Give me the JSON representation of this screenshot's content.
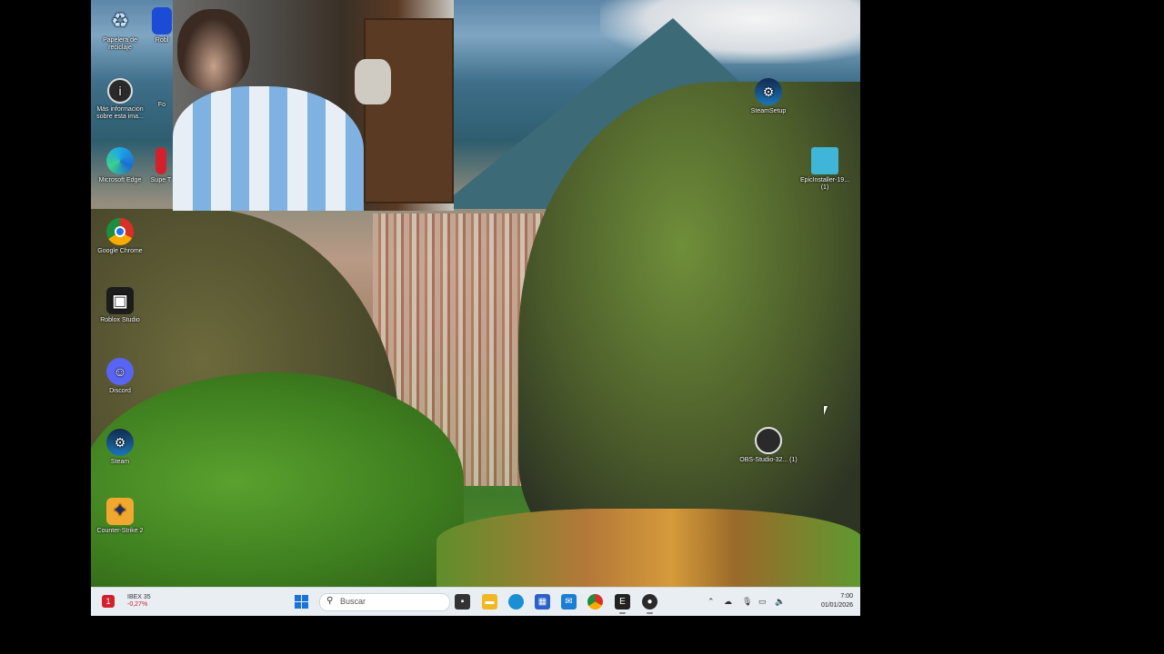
{
  "desktop": {
    "icons_left": [
      {
        "label": "Papelera de reciclaje",
        "icon": "recycle-bin-icon"
      },
      {
        "label": "Más información sobre esta ima...",
        "icon": "info-icon"
      },
      {
        "label": "Microsoft Edge",
        "icon": "edge-icon"
      },
      {
        "label": "Google Chrome",
        "icon": "chrome-icon"
      },
      {
        "label": "Roblox Studio",
        "icon": "roblox-studio-icon"
      },
      {
        "label": "Discord",
        "icon": "discord-icon"
      },
      {
        "label": "Steam",
        "icon": "steam-icon"
      },
      {
        "label": "Counter-Strike 2",
        "icon": "counter-strike-icon"
      }
    ],
    "icons_partial": [
      {
        "label": "Robl",
        "icon": "roblox-icon"
      },
      {
        "label": "Fo",
        "icon": "unknown-icon"
      },
      {
        "label": "Supe T",
        "icon": "app-icon"
      }
    ],
    "icons_right": [
      {
        "label": "SteamSetup",
        "icon": "steam-setup-icon"
      },
      {
        "label": "EpicInstaller-19... (1)",
        "icon": "epic-installer-icon"
      },
      {
        "label": "OBS-Studio-32... (1)",
        "icon": "obs-studio-icon"
      }
    ]
  },
  "taskbar": {
    "weather": {
      "label": "IBEX 35",
      "change": "-0,27%",
      "badge": "1"
    },
    "search_placeholder": "Buscar",
    "apps": [
      {
        "name": "task-view-icon",
        "color": "#333333"
      },
      {
        "name": "file-explorer-icon",
        "color": "#f2b824"
      },
      {
        "name": "edge-icon",
        "color": "#1b8fd6"
      },
      {
        "name": "store-icon",
        "color": "#2a62c9"
      },
      {
        "name": "mail-icon",
        "color": "#1a7fd4"
      },
      {
        "name": "chrome-icon",
        "color": "#d93025"
      },
      {
        "name": "epic-games-icon",
        "color": "#222222"
      },
      {
        "name": "obs-icon",
        "color": "#2a2a2a"
      }
    ],
    "clock": {
      "time": "7:00",
      "date": "01/01/2026"
    }
  }
}
